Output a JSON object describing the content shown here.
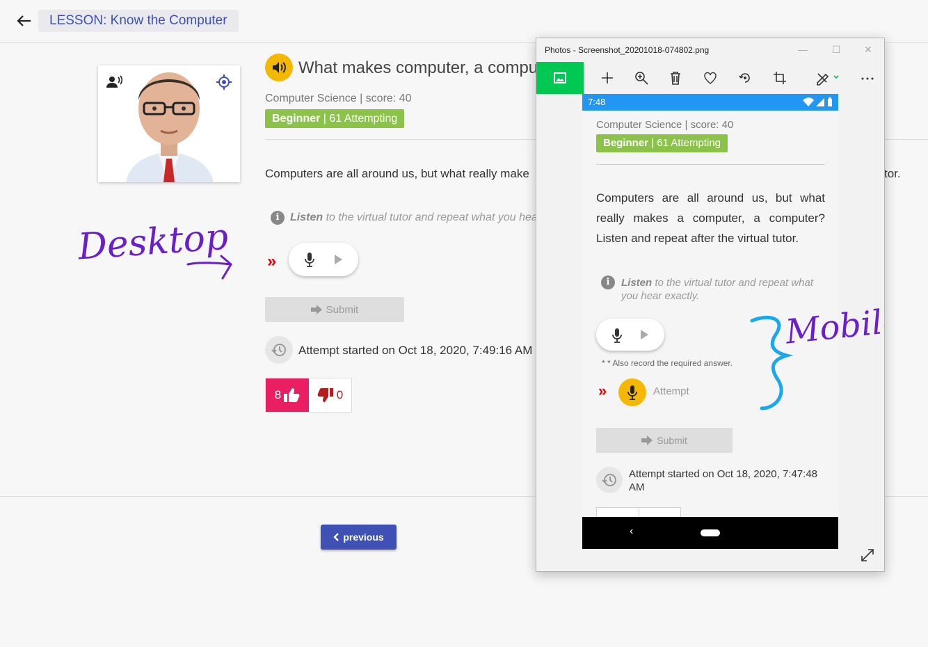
{
  "header": {
    "lesson_title": "LESSON: Know the Computer"
  },
  "question": {
    "title": "What makes computer, a compu",
    "subject_score": "Computer Science | score: 40",
    "level": "Beginner",
    "attempting": " | 61 Attempting",
    "description": "Computers are all around us, but what really make",
    "description_tail": "tor.",
    "instruction_bold": "Listen",
    "instruction_rest": " to the virtual tutor and repeat what you hea"
  },
  "desktop": {
    "arrow": "»",
    "submit_label": "Submit",
    "attempt_started": "Attempt started on Oct 18, 2020, 7:49:16 AM",
    "likes": "8",
    "dislikes": "0",
    "previous_label": "previous"
  },
  "photos_window": {
    "title": "Photos - Screenshot_20201018-074802.png",
    "controls": {
      "minimize": "—",
      "maximize": "☐",
      "close": "✕"
    }
  },
  "mobile": {
    "time": "7:48",
    "subject_score": "Computer Science | score: 40",
    "level": "Beginner",
    "attempting": " | 61 Attempting",
    "description": "Computers are all around us, but what really makes a computer, a computer? Listen and repeat after the virtual tutor.",
    "instruction_bold": "Listen",
    "instruction_rest": " to the virtual tutor and repeat what you hear exactly.",
    "record_note": "* * Also record the required answer.",
    "arrow": "»",
    "attempt_label": "Attempt",
    "submit_label": "Submit",
    "attempt_started": "Attempt started on Oct 18, 2020, 7:47:48 AM",
    "nav_back": "‹"
  },
  "annotations": {
    "desktop": "Desktop",
    "mobile": "Mobile"
  },
  "colors": {
    "accent": "#3f51b5",
    "badge": "#8bc34a",
    "like": "#e91e63",
    "speaker": "#f5b800",
    "status_bar": "#2196f3",
    "photos_green": "#00c853"
  }
}
